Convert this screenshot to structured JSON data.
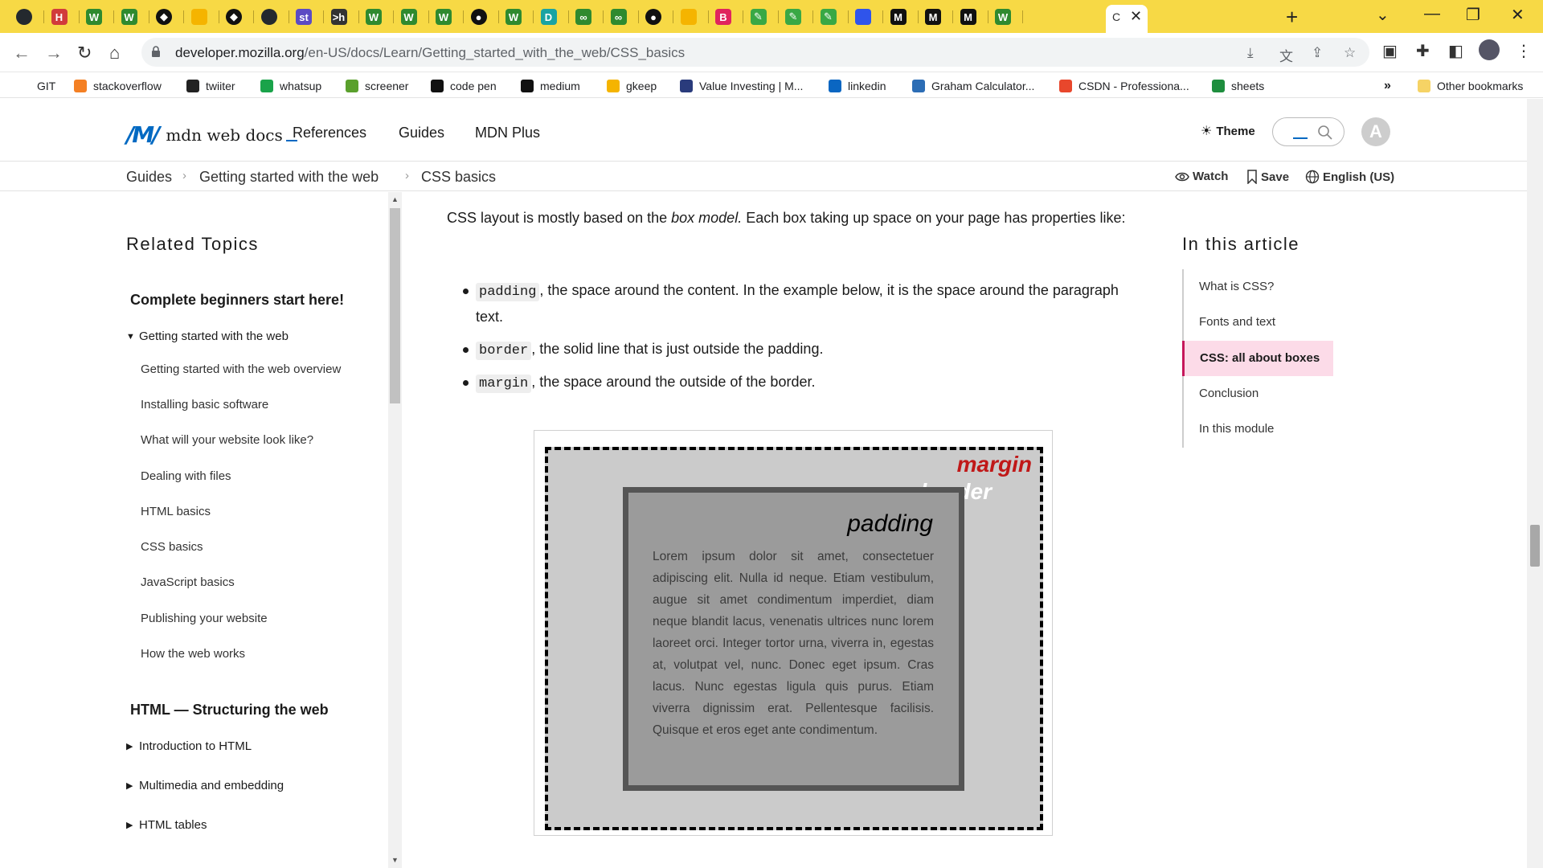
{
  "browser": {
    "active_tab_label": "C",
    "tabs": [
      {
        "icon": "github-icon",
        "color": "#24292e",
        "letter": ""
      },
      {
        "icon": "h-icon",
        "color": "#d13b3b",
        "letter": "H"
      },
      {
        "icon": "w-icon",
        "color": "#2f8a2f",
        "letter": "W"
      },
      {
        "icon": "w-icon",
        "color": "#2f8a2f",
        "letter": "W"
      },
      {
        "icon": "codepen-icon",
        "color": "#111",
        "letter": "◆"
      },
      {
        "icon": "keep-icon",
        "color": "#f5b400",
        "letter": ""
      },
      {
        "icon": "codepen-icon",
        "color": "#111",
        "letter": "◆"
      },
      {
        "icon": "github-icon",
        "color": "#24292e",
        "letter": ""
      },
      {
        "icon": "st-icon",
        "color": "#5b4bc4",
        "letter": "st"
      },
      {
        "icon": "terminal-icon",
        "color": "#333",
        "letter": ">h"
      },
      {
        "icon": "w-icon",
        "color": "#2f8a2f",
        "letter": "W"
      },
      {
        "icon": "w-icon",
        "color": "#2f8a2f",
        "letter": "W"
      },
      {
        "icon": "w-icon",
        "color": "#2f8a2f",
        "letter": "W"
      },
      {
        "icon": "globe-icon",
        "color": "#111",
        "letter": "●"
      },
      {
        "icon": "w-icon",
        "color": "#2f8a2f",
        "letter": "W"
      },
      {
        "icon": "d-icon",
        "color": "#1aa3a3",
        "letter": "D"
      },
      {
        "icon": "infinity-icon",
        "color": "#2f8a2f",
        "letter": "∞"
      },
      {
        "icon": "infinity-icon",
        "color": "#2f8a2f",
        "letter": "∞"
      },
      {
        "icon": "globe-icon",
        "color": "#111",
        "letter": "●"
      },
      {
        "icon": "keep-icon",
        "color": "#f5b400",
        "letter": ""
      },
      {
        "icon": "b-icon",
        "color": "#e0245e",
        "letter": "B"
      },
      {
        "icon": "edit-icon",
        "color": "#39a845",
        "letter": "✎"
      },
      {
        "icon": "edit-icon",
        "color": "#39a845",
        "letter": "✎"
      },
      {
        "icon": "edit-icon",
        "color": "#39a845",
        "letter": "✎"
      },
      {
        "icon": "blue-icon",
        "color": "#2f54eb",
        "letter": ""
      },
      {
        "icon": "mdn-icon",
        "color": "#111",
        "letter": "M"
      },
      {
        "icon": "mdn-icon",
        "color": "#111",
        "letter": "M"
      },
      {
        "icon": "mdn-icon",
        "color": "#111",
        "letter": "M"
      },
      {
        "icon": "w-icon",
        "color": "#2f8a2f",
        "letter": "W"
      }
    ],
    "url_host": "developer.mozilla.org",
    "url_path": "/en-US/docs/Learn/Getting_started_with_the_web/CSS_basics",
    "bookmarks": [
      {
        "label": "GIT",
        "icon": "none",
        "color": ""
      },
      {
        "label": "stackoverflow",
        "icon": "stackoverflow-icon",
        "color": "#f48024"
      },
      {
        "label": "twiiter",
        "icon": "globe-icon",
        "color": "#222"
      },
      {
        "label": "whatsup",
        "icon": "one-icon",
        "color": "#1aa34a"
      },
      {
        "label": "screener",
        "icon": "bars-icon",
        "color": "#5aa02c"
      },
      {
        "label": "code pen",
        "icon": "codepen-icon",
        "color": "#111"
      },
      {
        "label": "medium",
        "icon": "medium-icon",
        "color": "#111"
      },
      {
        "label": "gkeep",
        "icon": "keep-icon",
        "color": "#f5b400"
      },
      {
        "label": "Value Investing | M...",
        "icon": "vi-icon",
        "color": "#2a3b7c"
      },
      {
        "label": "linkedin",
        "icon": "linkedin-icon",
        "color": "#0a66c2"
      },
      {
        "label": "Graham Calculator...",
        "icon": "person-icon",
        "color": "#2c6db5"
      },
      {
        "label": "CSDN - Professiona...",
        "icon": "csdn-icon",
        "color": "#e8472c"
      },
      {
        "label": "sheets",
        "icon": "sheets-icon",
        "color": "#1e8e3e"
      }
    ],
    "bookmarks_overflow": "»",
    "other_bookmarks": "Other bookmarks"
  },
  "header": {
    "logo_text": "mdn web docs",
    "nav": [
      "References",
      "Guides",
      "MDN Plus"
    ],
    "theme_label": "Theme",
    "avatar_letter": "A"
  },
  "breadcrumbs": [
    "Guides",
    "Getting started with the web",
    "CSS basics"
  ],
  "page_actions": {
    "watch": "Watch",
    "save": "Save",
    "language": "English (US)"
  },
  "sidebar": {
    "title": "Related Topics",
    "section1": "Complete beginners start here!",
    "group1": "Getting started with the web",
    "items": [
      "Getting started with the web overview",
      "Installing basic software",
      "What will your website look like?",
      "Dealing with files",
      "HTML basics",
      "CSS basics",
      "JavaScript basics",
      "Publishing your website",
      "How the web works"
    ],
    "section2": "HTML — Structuring the web",
    "groups2": [
      "Introduction to HTML",
      "Multimedia and embedding",
      "HTML tables"
    ]
  },
  "content": {
    "intro_pre": "CSS layout is mostly based on the ",
    "intro_em": "box model.",
    "intro_post": " Each box taking up space on your page has properties like:",
    "bullets": [
      {
        "code": "padding",
        "text": ", the space around the content. In the example below, it is the space around the paragraph text."
      },
      {
        "code": "border",
        "text": ", the solid line that is just outside the padding."
      },
      {
        "code": "margin",
        "text": ", the space around the outside of the border."
      }
    ],
    "figure": {
      "margin_label": "margin",
      "border_label": "border",
      "padding_label": "padding",
      "lorem": "Lorem ipsum dolor sit amet, consectetuer adipiscing elit. Nulla id neque. Etiam vestibulum, augue sit amet condimentum imperdiet, diam neque blandit lacus, venenatis ultrices nunc lorem laoreet orci. Integer tortor urna, viverra in, egestas at, volutpat vel, nunc. Donec eget ipsum. Cras lacus. Nunc egestas ligula quis purus. Etiam viverra dignissim erat. Pellentesque facilisis. Quisque et eros eget ante condimentum."
    }
  },
  "toc": {
    "title": "In this article",
    "items": [
      "What is CSS?",
      "Fonts and text",
      "CSS: all about boxes",
      "Conclusion",
      "In this module"
    ],
    "active": "CSS: all about boxes"
  },
  "colors": {
    "tabstrip": "#f7d945",
    "mdn_blue": "#0069c2",
    "toc_active_bg": "#fcdbe8",
    "toc_active_border": "#c6175b",
    "margin_label": "#c01818"
  }
}
